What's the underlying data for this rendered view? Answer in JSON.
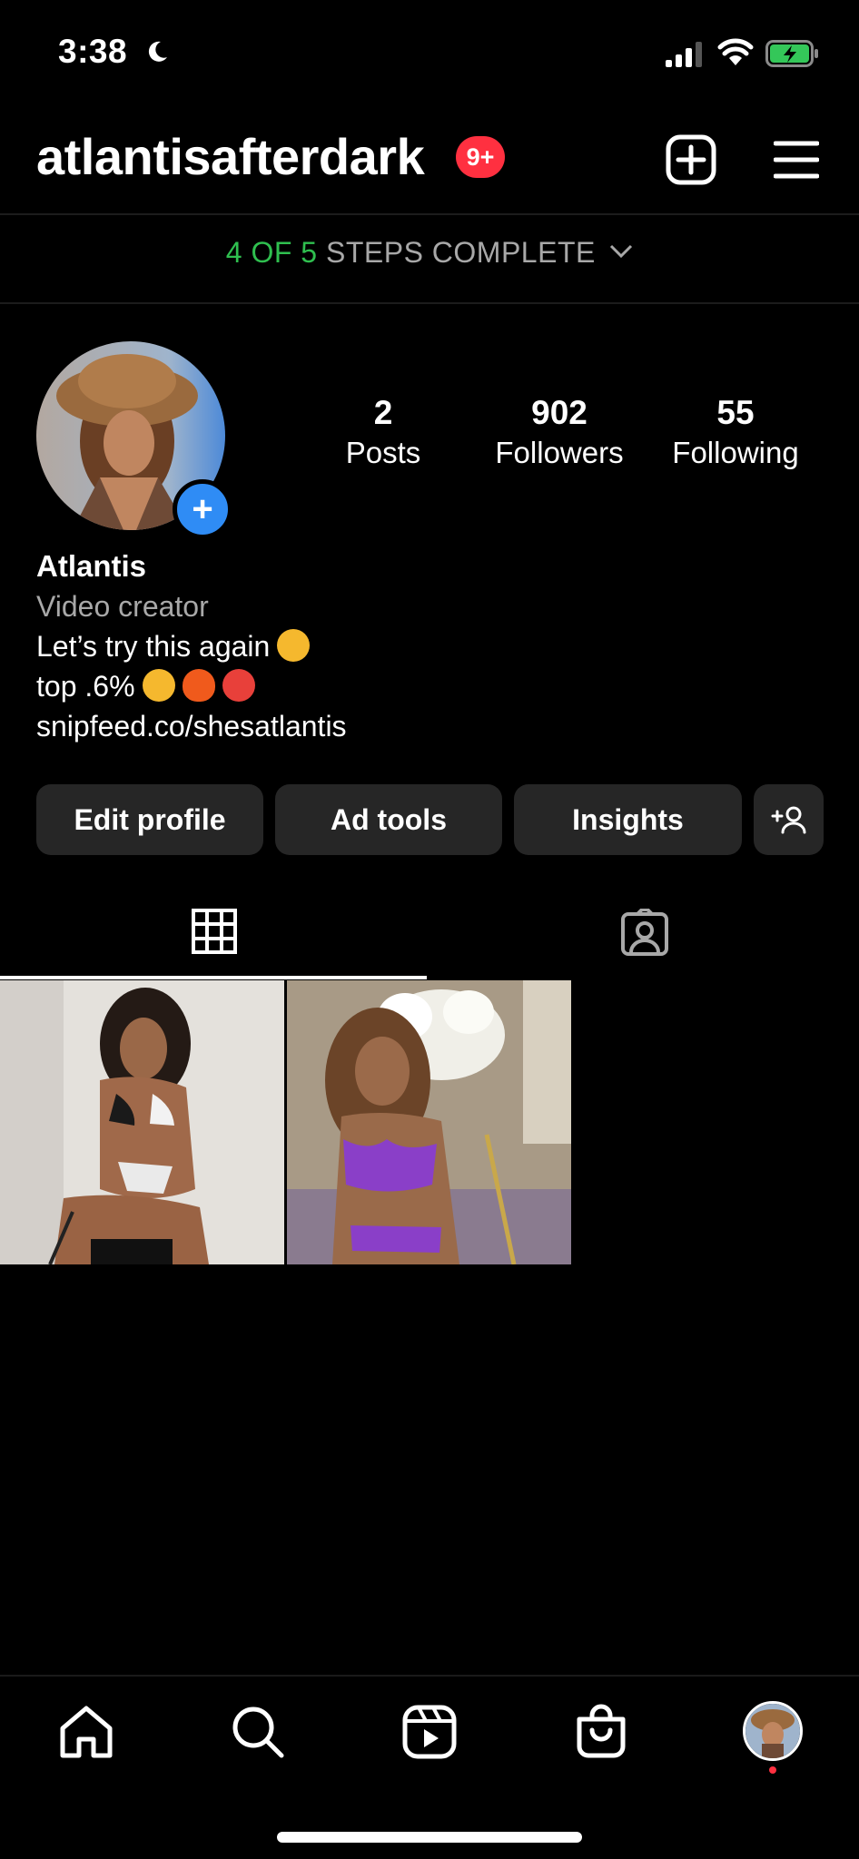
{
  "status_bar": {
    "time": "3:38"
  },
  "header": {
    "username": "atlantisafterdark",
    "notification_badge": "9+"
  },
  "steps_banner": {
    "done": "4 OF 5",
    "rest": "STEPS COMPLETE"
  },
  "stats": [
    {
      "value": "2",
      "label": "Posts"
    },
    {
      "value": "902",
      "label": "Followers"
    },
    {
      "value": "55",
      "label": "Following"
    }
  ],
  "bio": {
    "display_name": "Atlantis",
    "category": "Video creator",
    "line1": "Let’s try this again",
    "line2": "top .6%",
    "link": "snipfeed.co/shesatlantis"
  },
  "buttons": {
    "edit_profile": "Edit profile",
    "ad_tools": "Ad tools",
    "insights": "Insights"
  },
  "colors": {
    "accent_green": "#2fbf4f",
    "badge_red": "#ff3040",
    "plus_blue": "#2f8cf5",
    "button_bg": "#262626"
  },
  "icons": [
    "moon-icon",
    "signal-icon",
    "wifi-icon",
    "battery-icon",
    "new-post-icon",
    "menu-icon",
    "chevron-down-icon",
    "add-person-icon",
    "grid-icon",
    "tagged-icon",
    "home-icon",
    "search-icon",
    "reels-icon",
    "shop-icon"
  ]
}
